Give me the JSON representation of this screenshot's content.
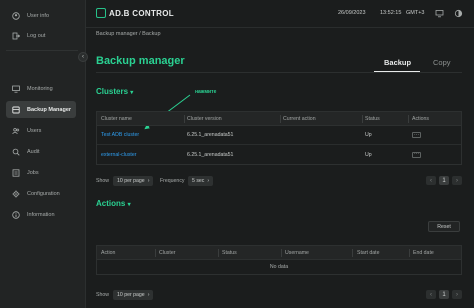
{
  "sidebar": {
    "items": [
      {
        "label": "User info",
        "icon": "user-icon"
      },
      {
        "label": "Log out",
        "icon": "logout-icon"
      },
      {
        "label": "Monitoring",
        "icon": "monitor-icon"
      },
      {
        "label": "Backup Manager",
        "icon": "backup-icon",
        "active": true
      },
      {
        "label": "Users",
        "icon": "users-icon"
      },
      {
        "label": "Audit",
        "icon": "audit-icon"
      },
      {
        "label": "Jobs",
        "icon": "jobs-icon"
      },
      {
        "label": "Configuration",
        "icon": "config-icon"
      },
      {
        "label": "Information",
        "icon": "info-icon"
      }
    ],
    "collapse_glyph": "‹"
  },
  "header": {
    "logo_text": "AD.B CONTROL",
    "date": "26/09/2023",
    "time": "13:52:15",
    "timezone": "GMT+3"
  },
  "breadcrumb": "Backup manager / Backup",
  "page_title": "Backup manager",
  "tabs": [
    {
      "label": "Backup",
      "active": true
    },
    {
      "label": "Copy",
      "active": false
    }
  ],
  "clusters": {
    "title": "Clusters",
    "annotation": "нажмите",
    "columns": [
      "Cluster name",
      "Cluster version",
      "Current action",
      "Status",
      "Actions"
    ],
    "rows": [
      {
        "name": "Test ADB cluster",
        "version": "6.25.1_arenadata51",
        "action": "",
        "status": "Up",
        "actions_glyph": "···"
      },
      {
        "name": "external-cluster",
        "version": "6.25.1_arenadata51",
        "action": "",
        "status": "Up",
        "actions_glyph": "···"
      }
    ],
    "pager": {
      "show_label": "Show",
      "per_page": "10 per page",
      "frequency_label": "Frequency",
      "frequency": "5 sec"
    }
  },
  "actions": {
    "title": "Actions",
    "reset_label": "Reset",
    "columns": [
      "Action",
      "Cluster",
      "Status",
      "Username",
      "Start date",
      "End date"
    ],
    "empty_text": "No data",
    "pager": {
      "show_label": "Show",
      "per_page": "10 per page"
    }
  },
  "pagination_glyphs": {
    "prev": "‹",
    "page": "1",
    "next": "›"
  },
  "colors": {
    "accent": "#2ad192",
    "link": "#2e9ef0",
    "bg": "#1b1d1d",
    "sidebar": "#222424"
  }
}
